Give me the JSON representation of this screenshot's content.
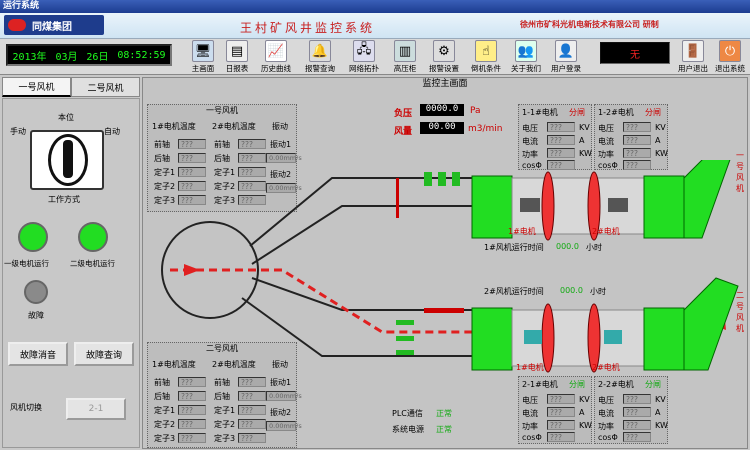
{
  "window_title": "运行系统",
  "header": {
    "logo_text": "同煤集团",
    "system_title": "王村矿风井监控系统",
    "company": "徐州市矿科光机电新技术有限公司 研制"
  },
  "clock": {
    "year": "2013年",
    "month": "03月",
    "day": "26日",
    "time": "08:52:59"
  },
  "toolbar": {
    "items": [
      {
        "label": "主画面"
      },
      {
        "label": "日报表"
      },
      {
        "label": "历史曲线"
      },
      {
        "label": "报警查询"
      },
      {
        "label": "网络拓扑"
      },
      {
        "label": "高压柜"
      },
      {
        "label": "报警设置"
      },
      {
        "label": "倒机条件"
      },
      {
        "label": "关于我们"
      },
      {
        "label": "用户登录"
      }
    ],
    "user_status": "无",
    "logout_label": "用户退出",
    "exit_label": "退出系统"
  },
  "left": {
    "tab1": "一号风机",
    "tab2": "二号风机",
    "local_label": "本位",
    "manual_label": "手动",
    "auto_label": "自动",
    "mode_label": "工作方式",
    "fan1_run": "一级电机运行",
    "fan2_run": "二级电机运行",
    "fault_label": "故障",
    "btn_silence": "故障消音",
    "btn_query": "故障查询",
    "switch_label": "风机切换",
    "switch_value": "2-1"
  },
  "main": {
    "title": "监控主画面",
    "pressure_label": "负压",
    "pressure_value": "0000.0",
    "pressure_unit": "Pa",
    "airflow_label": "风量",
    "airflow_value": "00.00",
    "airflow_unit": "m3/min",
    "fan1_runtime_label": "1#风机运行时间",
    "fan1_runtime": "000.0",
    "fan2_runtime_label": "2#风机运行时间",
    "fan2_runtime": "000.0",
    "hour_unit": "小时",
    "plc_label": "PLC通信",
    "plc_status": "正常",
    "power_label": "系统电源",
    "power_status": "正常",
    "fan1_side": "一号风机",
    "fan2_side": "二号风机",
    "motor1": "1#电机",
    "motor2": "2#电机"
  },
  "fan1_box": {
    "title": "一号风机",
    "h1": "1#电机温度",
    "h2": "2#电机温度",
    "h3": "振动",
    "rows": [
      "前轴",
      "后轴",
      "定子1",
      "定子2",
      "定子3"
    ],
    "vib1": "振动1",
    "vib2": "振动2",
    "placeholder": "???",
    "vib_unit": "0.00mm/s"
  },
  "fan2_box": {
    "title": "二号风机",
    "h1": "1#电机温度",
    "h2": "2#电机温度",
    "h3": "振动",
    "rows": [
      "前轴",
      "后轴",
      "定子1",
      "定子2",
      "定子3"
    ],
    "vib1": "振动1",
    "vib2": "振动2",
    "placeholder": "???",
    "vib_unit": "0.00mm/s"
  },
  "motor_boxes": [
    {
      "title": "1-1#电机",
      "state": "分闸"
    },
    {
      "title": "1-2#电机",
      "state": "分闸"
    },
    {
      "title": "2-1#电机",
      "state": "分闸"
    },
    {
      "title": "2-2#电机",
      "state": "分闸"
    }
  ],
  "motor_fields": {
    "voltage": "电压",
    "current": "电流",
    "power": "功率",
    "pf": "cosΦ",
    "ph": "???",
    "kv": "KV",
    "a": "A",
    "kw": "KW"
  },
  "colors": {
    "accent_red": "#c82020",
    "run_green": "#22dd22",
    "fault_gray": "#8a8a8a"
  }
}
